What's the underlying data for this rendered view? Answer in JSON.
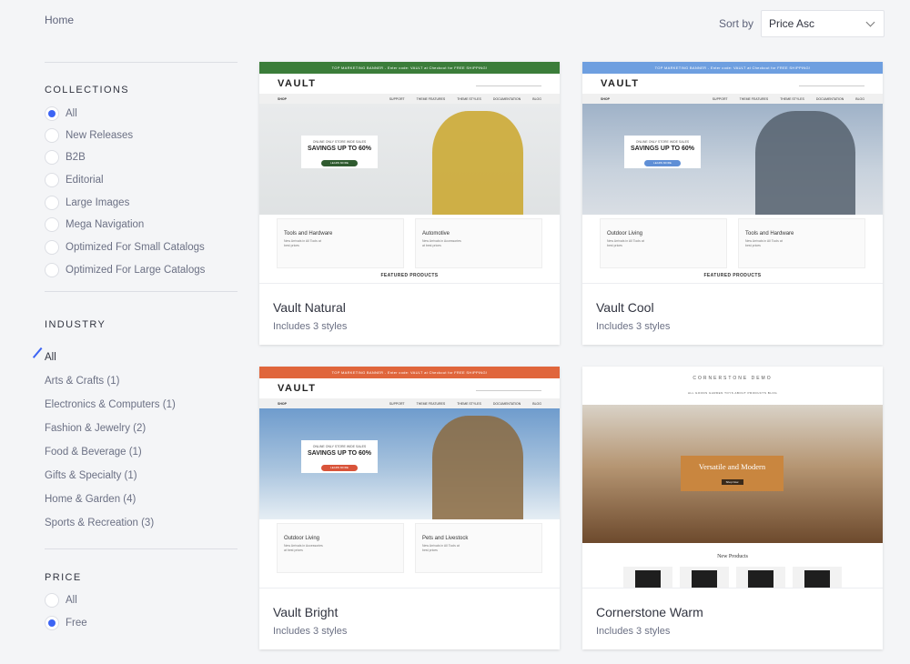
{
  "breadcrumb": "Home",
  "sort": {
    "label": "Sort by",
    "selected": "Price Asc"
  },
  "collections": {
    "title": "COLLECTIONS",
    "options": [
      "All",
      "New Releases",
      "B2B",
      "Editorial",
      "Large Images",
      "Mega Navigation",
      "Optimized For Small Catalogs",
      "Optimized For Large Catalogs"
    ],
    "selected_index": 0
  },
  "industry": {
    "title": "INDUSTRY",
    "options": [
      "All",
      "Arts & Crafts (1)",
      "Electronics & Computers (1)",
      "Fashion & Jewelry (2)",
      "Food & Beverage (1)",
      "Gifts & Specialty (1)",
      "Home & Garden (4)",
      "Sports & Recreation (3)"
    ],
    "active_index": 0
  },
  "price": {
    "title": "PRICE",
    "options": [
      "All",
      "Free"
    ],
    "selected_index": 1
  },
  "themes": [
    {
      "name": "Vault Natural",
      "styles": "Includes 3 styles",
      "accent": "#3b7d3a",
      "button": "#2f5b2f",
      "banner": "TOP MARKETING BANNER - Enter code: VAULT at Checkout for FREE SHIPPING!",
      "logo": "VAULT",
      "nav": [
        "SHOP",
        "SUPPORT",
        "THEME FEATURES",
        "THEME STYLES",
        "DOCUMENTATION",
        "BLOG"
      ],
      "promo_small": "ONLINE ONLY STORE WIDE SALES",
      "promo_big": "SAVINGS UP TO 60%",
      "promo_btn": "LEARN MORE",
      "cats": [
        {
          "name": "Tools and Hardware",
          "sub": "New Arrivals in All Tools at best prices"
        },
        {
          "name": "Automotive",
          "sub": "New Arrivals in Accessories at best prices"
        }
      ],
      "featured": "FEATURED PRODUCTS"
    },
    {
      "name": "Vault Cool",
      "styles": "Includes 3 styles",
      "accent": "#6e9fe0",
      "button": "#5f8fd6",
      "banner": "TOP MARKETING BANNER - Enter code: VAULT at Checkout for FREE SHIPPING!",
      "logo": "VAULT",
      "nav": [
        "SHOP",
        "SUPPORT",
        "THEME FEATURES",
        "THEME STYLES",
        "DOCUMENTATION",
        "BLOG"
      ],
      "promo_small": "ONLINE ONLY STORE WIDE SALES",
      "promo_big": "SAVINGS UP TO 60%",
      "promo_btn": "LEARN MORE",
      "cats": [
        {
          "name": "Outdoor Living",
          "sub": "New Arrivals in All Tools at best prices"
        },
        {
          "name": "Tools and Hardware",
          "sub": "New Arrivals in All Tools at best prices"
        }
      ],
      "featured": "FEATURED PRODUCTS"
    },
    {
      "name": "Vault Bright",
      "styles": "Includes 3 styles",
      "accent": "#e0663c",
      "button": "#d9543a",
      "banner": "TOP MARKETING BANNER - Enter code: VAULT at Checkout for FREE SHIPPING!",
      "logo": "VAULT",
      "nav": [
        "SHOP",
        "SUPPORT",
        "THEME FEATURES",
        "THEME STYLES",
        "DOCUMENTATION",
        "BLOG"
      ],
      "promo_small": "ONLINE ONLY STORE WIDE SALES",
      "promo_big": "SAVINGS UP TO 60%",
      "promo_btn": "LEARN MORE",
      "cats": [
        {
          "name": "Outdoor Living",
          "sub": "New Arrivals in Accessories at best prices"
        },
        {
          "name": "Pets and Livestock",
          "sub": "New Arrivals in All Tools at best prices"
        }
      ],
      "featured": ""
    },
    {
      "name": "Cornerstone Warm",
      "styles": "Includes 3 styles",
      "accent": "#c9863f",
      "logo": "CORNERSTONE DEMO",
      "nav_text": "ALL GOODS   GARDEN   TOYS   ABOUT   PRODUCTS   BLOG",
      "hero_title": "Versatile and Modern",
      "hero_btn": "Shop Now",
      "new_products": "New Products"
    }
  ]
}
